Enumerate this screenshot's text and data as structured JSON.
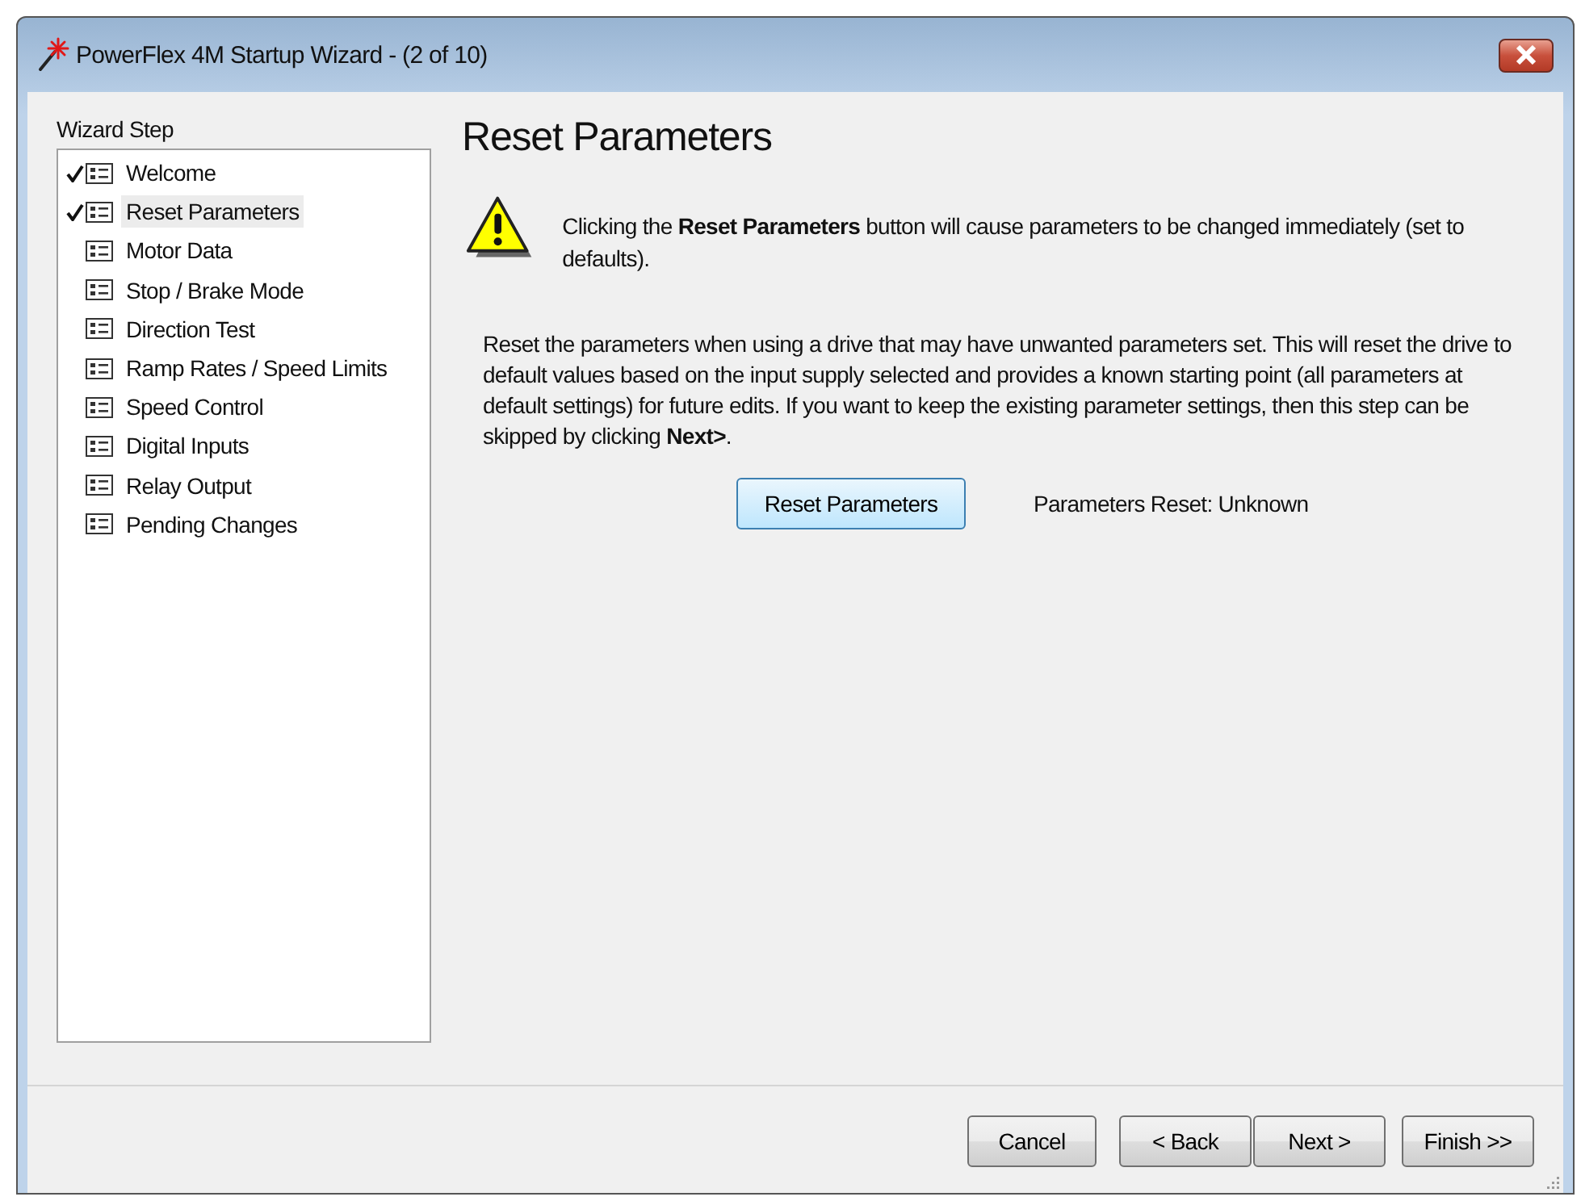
{
  "window": {
    "title": "PowerFlex 4M Startup Wizard - (2 of 10)"
  },
  "sidebar": {
    "label": "Wizard Step",
    "items": [
      {
        "label": "Welcome",
        "checked": true,
        "selected": false
      },
      {
        "label": "Reset Parameters",
        "checked": true,
        "selected": true
      },
      {
        "label": "Motor Data",
        "checked": false,
        "selected": false
      },
      {
        "label": "Stop / Brake Mode",
        "checked": false,
        "selected": false
      },
      {
        "label": "Direction Test",
        "checked": false,
        "selected": false
      },
      {
        "label": "Ramp Rates / Speed Limits",
        "checked": false,
        "selected": false
      },
      {
        "label": "Speed Control",
        "checked": false,
        "selected": false
      },
      {
        "label": "Digital Inputs",
        "checked": false,
        "selected": false
      },
      {
        "label": "Relay Output",
        "checked": false,
        "selected": false
      },
      {
        "label": "Pending Changes",
        "checked": false,
        "selected": false
      }
    ]
  },
  "page": {
    "heading": "Reset Parameters",
    "warning": "Clicking the **Reset Parameters** button will cause parameters to be changed immediately (set to defaults).",
    "description": "Reset the parameters when using a drive that may have unwanted parameters set. This will reset the drive to default values based on the input supply selected and provides a known starting point (all parameters at default settings) for future edits.  If you want to keep the existing parameter settings, then this step can be skipped by clicking **Next>**.",
    "action_button": "Reset Parameters",
    "status": "Parameters Reset: Unknown"
  },
  "buttons": [
    "Cancel",
    "< Back",
    "Next >",
    "Finish >>"
  ]
}
